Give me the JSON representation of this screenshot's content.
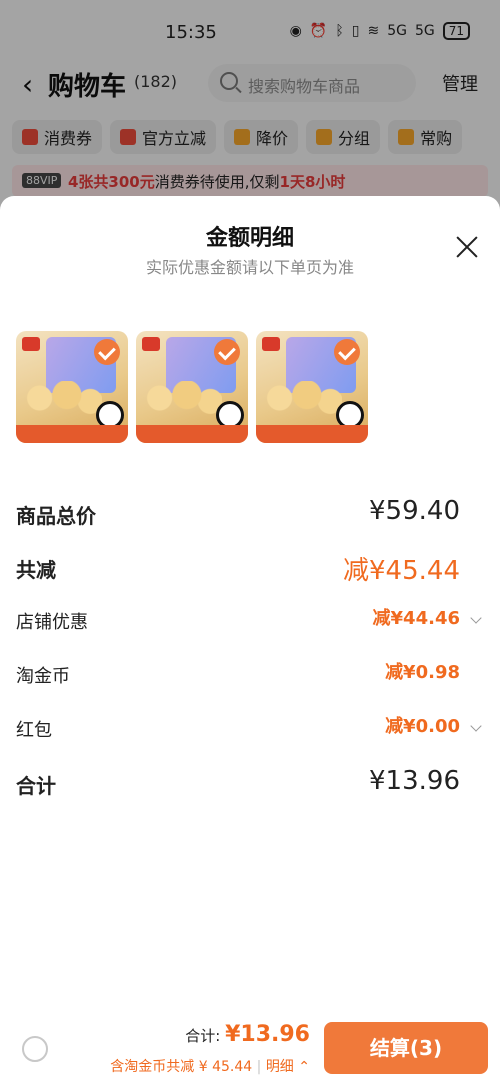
{
  "status_bar": {
    "time": "15:35",
    "network1": "5G",
    "network2": "5G",
    "battery": "71"
  },
  "header": {
    "back_icon": "chevron-left-icon",
    "title": "购物车",
    "count": "(182)",
    "search_placeholder": "搜索购物车商品",
    "manage": "管理"
  },
  "chips": [
    {
      "label": "消费券",
      "icon": "coupon-icon",
      "color": "#e84a3a"
    },
    {
      "label": "官方立减",
      "icon": "lightning-icon",
      "color": "#e84a3a"
    },
    {
      "label": "降价",
      "icon": "arrow-down-icon",
      "color": "#f0a32a"
    },
    {
      "label": "分组",
      "icon": "folder-icon",
      "color": "#f0a32a"
    },
    {
      "label": "常购",
      "icon": "cart-icon",
      "color": "#f0a32a"
    }
  ],
  "banner": {
    "vip": "88VIP",
    "highlight": "4张共300元",
    "text1": "消费券待使用,仅剩",
    "highlight2": "1天8小时"
  },
  "sheet": {
    "title": "金额明细",
    "subtitle": "实际优惠金额请以下单页为准",
    "rows": [
      {
        "label": "商品总价",
        "value": "¥59.40"
      },
      {
        "label": "共减",
        "value": "减¥45.44"
      },
      {
        "label": "店铺优惠",
        "value": "减¥44.46"
      },
      {
        "label": "淘金币",
        "value": "减¥0.98"
      },
      {
        "label": "红包",
        "value": "减¥0.00"
      },
      {
        "label": "合计",
        "value": "¥13.96"
      }
    ]
  },
  "bottom": {
    "total_label": "合计:",
    "total_value": "¥13.96",
    "note": "含淘金币共减 ¥ 45.44",
    "detail": "明细",
    "checkout": "结算(3)"
  },
  "colors": {
    "accent": "#f06a1f",
    "checkout_bg": "#f0793a",
    "banner_bg": "#f6dfe0"
  }
}
